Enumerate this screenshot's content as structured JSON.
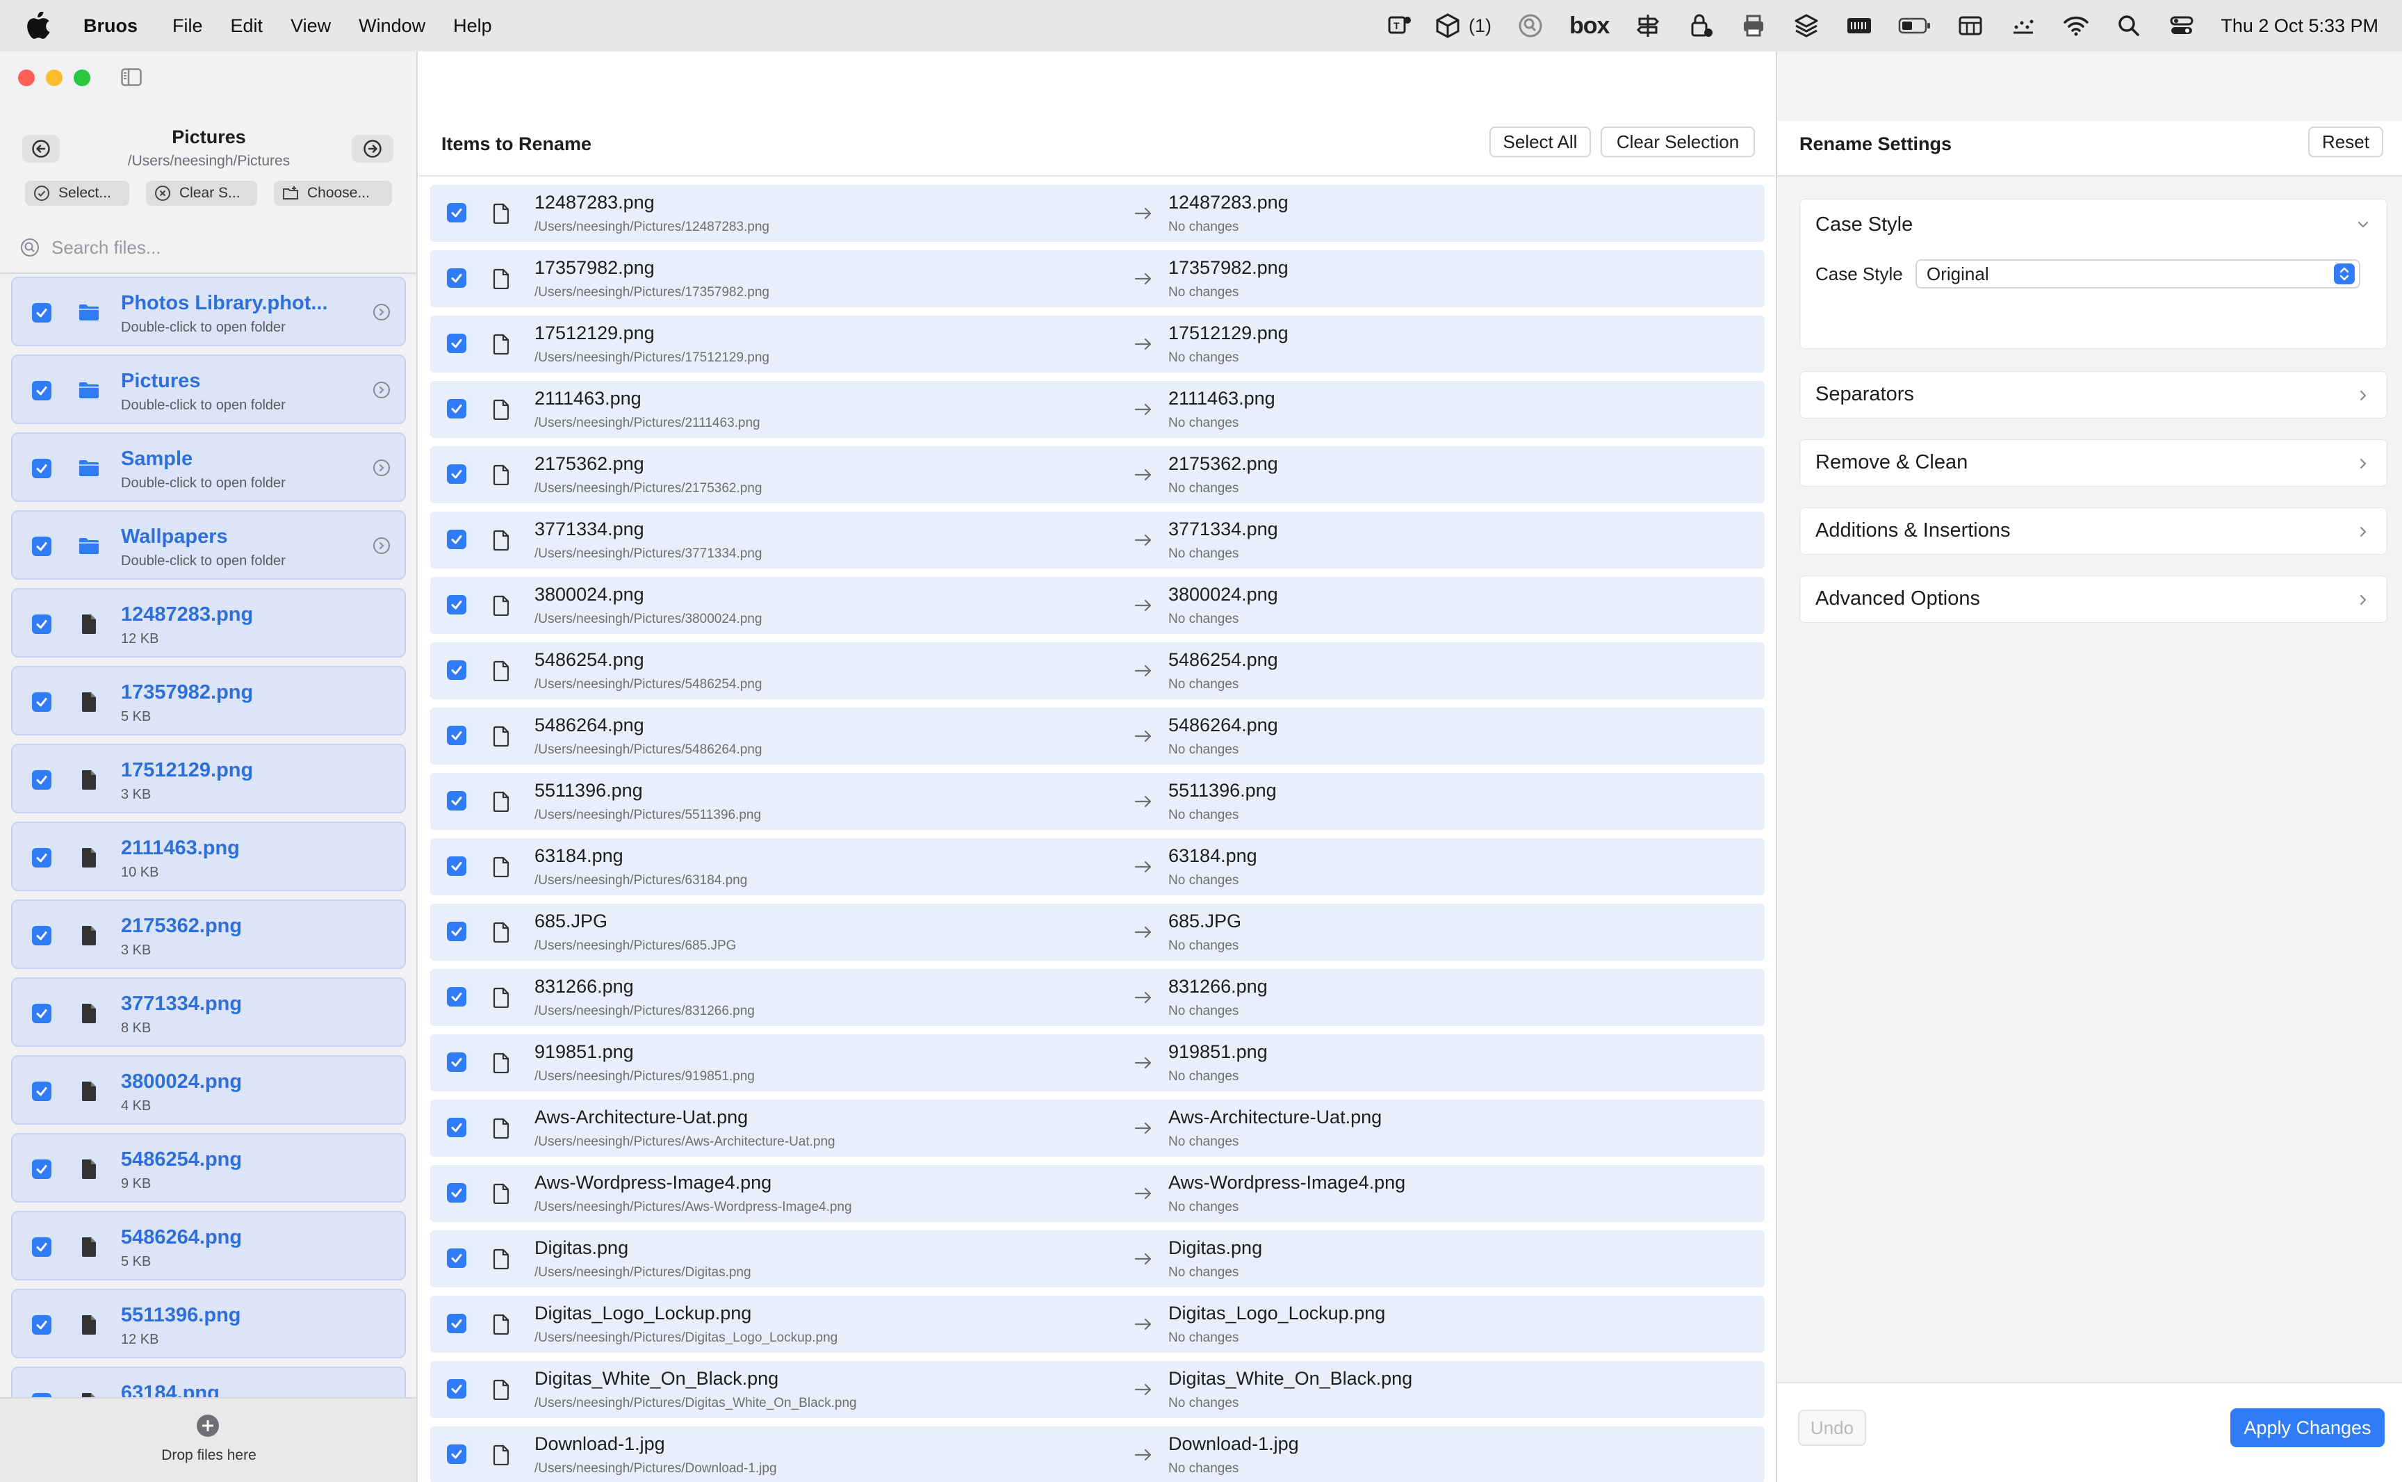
{
  "menubar": {
    "app_name": "Bruos",
    "menus": [
      "File",
      "Edit",
      "View",
      "Window",
      "Help"
    ],
    "badge_count": "(1)",
    "box_label": "box",
    "clock": "Thu 2 Oct  5:33 PM"
  },
  "sidebar": {
    "folder_title": "Pictures",
    "folder_path": "/Users/neesingh/Pictures",
    "select_label": "Select...",
    "clear_label": "Clear S...",
    "choose_label": "Choose...",
    "search_placeholder": "Search files...",
    "items": [
      {
        "name": "Photos Library.phot...",
        "sub": "Double-click to open folder",
        "kind": "folder"
      },
      {
        "name": "Pictures",
        "sub": "Double-click to open folder",
        "kind": "folder"
      },
      {
        "name": "Sample",
        "sub": "Double-click to open folder",
        "kind": "folder"
      },
      {
        "name": "Wallpapers",
        "sub": "Double-click to open folder",
        "kind": "folder"
      },
      {
        "name": "12487283.png",
        "sub": "12 KB",
        "kind": "file"
      },
      {
        "name": "17357982.png",
        "sub": "5 KB",
        "kind": "file"
      },
      {
        "name": "17512129.png",
        "sub": "3 KB",
        "kind": "file"
      },
      {
        "name": "2111463.png",
        "sub": "10 KB",
        "kind": "file"
      },
      {
        "name": "2175362.png",
        "sub": "3 KB",
        "kind": "file"
      },
      {
        "name": "3771334.png",
        "sub": "8 KB",
        "kind": "file"
      },
      {
        "name": "3800024.png",
        "sub": "4 KB",
        "kind": "file"
      },
      {
        "name": "5486254.png",
        "sub": "9 KB",
        "kind": "file"
      },
      {
        "name": "5486264.png",
        "sub": "5 KB",
        "kind": "file"
      },
      {
        "name": "5511396.png",
        "sub": "12 KB",
        "kind": "file"
      },
      {
        "name": "63184.png",
        "sub": "",
        "kind": "file"
      }
    ],
    "drop_label": "Drop files here"
  },
  "middle": {
    "title": "Items to Rename",
    "select_all_label": "Select All",
    "clear_selection_label": "Clear Selection",
    "rows": [
      {
        "name": "12487283.png",
        "path": "/Users/neesingh/Pictures/12487283.png",
        "new_name": "12487283.png",
        "status": "No changes"
      },
      {
        "name": "17357982.png",
        "path": "/Users/neesingh/Pictures/17357982.png",
        "new_name": "17357982.png",
        "status": "No changes"
      },
      {
        "name": "17512129.png",
        "path": "/Users/neesingh/Pictures/17512129.png",
        "new_name": "17512129.png",
        "status": "No changes"
      },
      {
        "name": "2111463.png",
        "path": "/Users/neesingh/Pictures/2111463.png",
        "new_name": "2111463.png",
        "status": "No changes"
      },
      {
        "name": "2175362.png",
        "path": "/Users/neesingh/Pictures/2175362.png",
        "new_name": "2175362.png",
        "status": "No changes"
      },
      {
        "name": "3771334.png",
        "path": "/Users/neesingh/Pictures/3771334.png",
        "new_name": "3771334.png",
        "status": "No changes"
      },
      {
        "name": "3800024.png",
        "path": "/Users/neesingh/Pictures/3800024.png",
        "new_name": "3800024.png",
        "status": "No changes"
      },
      {
        "name": "5486254.png",
        "path": "/Users/neesingh/Pictures/5486254.png",
        "new_name": "5486254.png",
        "status": "No changes"
      },
      {
        "name": "5486264.png",
        "path": "/Users/neesingh/Pictures/5486264.png",
        "new_name": "5486264.png",
        "status": "No changes"
      },
      {
        "name": "5511396.png",
        "path": "/Users/neesingh/Pictures/5511396.png",
        "new_name": "5511396.png",
        "status": "No changes"
      },
      {
        "name": "63184.png",
        "path": "/Users/neesingh/Pictures/63184.png",
        "new_name": "63184.png",
        "status": "No changes"
      },
      {
        "name": "685.JPG",
        "path": "/Users/neesingh/Pictures/685.JPG",
        "new_name": "685.JPG",
        "status": "No changes"
      },
      {
        "name": "831266.png",
        "path": "/Users/neesingh/Pictures/831266.png",
        "new_name": "831266.png",
        "status": "No changes"
      },
      {
        "name": "919851.png",
        "path": "/Users/neesingh/Pictures/919851.png",
        "new_name": "919851.png",
        "status": "No changes"
      },
      {
        "name": "Aws-Architecture-Uat.png",
        "path": "/Users/neesingh/Pictures/Aws-Architecture-Uat.png",
        "new_name": "Aws-Architecture-Uat.png",
        "status": "No changes"
      },
      {
        "name": "Aws-Wordpress-Image4.png",
        "path": "/Users/neesingh/Pictures/Aws-Wordpress-Image4.png",
        "new_name": "Aws-Wordpress-Image4.png",
        "status": "No changes"
      },
      {
        "name": "Digitas.png",
        "path": "/Users/neesingh/Pictures/Digitas.png",
        "new_name": "Digitas.png",
        "status": "No changes"
      },
      {
        "name": "Digitas_Logo_Lockup.png",
        "path": "/Users/neesingh/Pictures/Digitas_Logo_Lockup.png",
        "new_name": "Digitas_Logo_Lockup.png",
        "status": "No changes"
      },
      {
        "name": "Digitas_White_On_Black.png",
        "path": "/Users/neesingh/Pictures/Digitas_White_On_Black.png",
        "new_name": "Digitas_White_On_Black.png",
        "status": "No changes"
      },
      {
        "name": "Download-1.jpg",
        "path": "/Users/neesingh/Pictures/Download-1.jpg",
        "new_name": "Download-1.jpg",
        "status": "No changes"
      }
    ]
  },
  "settings": {
    "title": "Rename Settings",
    "reset_label": "Reset",
    "case_style_header": "Case Style",
    "case_style_label": "Case Style",
    "case_style_value": "Original",
    "separators": "Separators",
    "remove_clean": "Remove & Clean",
    "additions": "Additions & Insertions",
    "advanced": "Advanced Options",
    "undo_label": "Undo",
    "apply_label": "Apply Changes"
  },
  "colors": {
    "accent": "#2f7cf6",
    "sidebar_item_bg": "#dce5f7",
    "row_bg": "#e8eefa",
    "link_text": "#2f6fd9"
  }
}
